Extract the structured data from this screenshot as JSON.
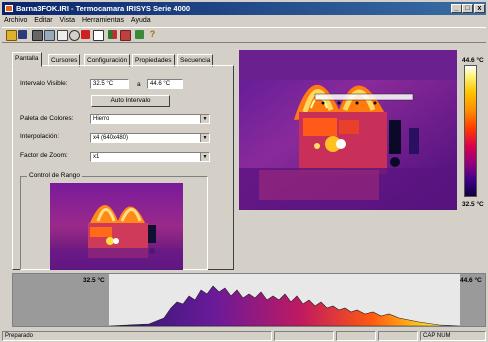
{
  "window": {
    "title": "Barna3FOK.IRI - Termocamara IRISYS Serie 4000"
  },
  "menu": [
    "Archivo",
    "Editar",
    "Vista",
    "Herramientas",
    "Ayuda"
  ],
  "tabs": [
    "Pantalla",
    "Cursores",
    "Configuración",
    "Propiedades",
    "Secuencia"
  ],
  "controls": {
    "intervalo_label": "Intervalo Visible:",
    "intervalo_min": "32.5 °C",
    "intervalo_sep": "a",
    "intervalo_max": "44.6 °C",
    "auto_button": "Auto Intervalo",
    "paleta_label": "Paleta de Colores:",
    "paleta_value": "Hierro",
    "interp_label": "Interpolación:",
    "interp_value": "x4 (640x480)",
    "zoom_label": "Factor de Zoom:",
    "zoom_value": "x1",
    "rango_label": "Control de Rango"
  },
  "colorbar": {
    "max": "44.6 °C",
    "min": "32.5 °C"
  },
  "histogram": {
    "left_label": "32.5 °C",
    "right_label": "44.6 °C"
  },
  "status": {
    "left": "Preparado",
    "right": "CAP NUM"
  },
  "icons": [
    "open-icon",
    "save-icon",
    "print-icon",
    "camera-icon",
    "cursor-icon",
    "crosshair-icon",
    "palette-icon",
    "rectangle-icon",
    "chart-icon",
    "stats-icon",
    "export-icon",
    "help-icon"
  ]
}
